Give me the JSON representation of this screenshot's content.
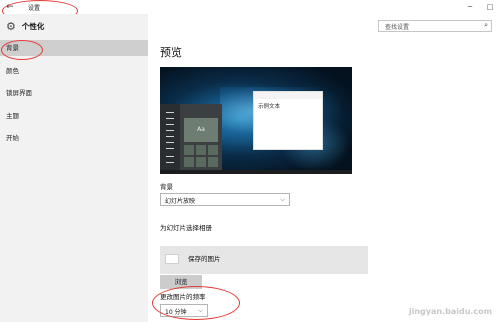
{
  "window": {
    "back_glyph": "←",
    "title": "设置",
    "minimize_glyph": "─",
    "maximize_glyph": "□"
  },
  "search": {
    "placeholder": "查找设置",
    "icon": "search-icon"
  },
  "sidebar": {
    "title": "个性化",
    "items": [
      {
        "label": "背景",
        "active": true
      },
      {
        "label": "颜色",
        "active": false
      },
      {
        "label": "锁屏界面",
        "active": false
      },
      {
        "label": "主题",
        "active": false
      },
      {
        "label": "开始",
        "active": false
      }
    ]
  },
  "main": {
    "title": "预览",
    "preview": {
      "tile_label": "Aa",
      "sample_text": "示例文本"
    },
    "background": {
      "label": "背景",
      "value": "幻灯片放映",
      "chevron": "⌵"
    },
    "album": {
      "label": "为幻灯片选择相册",
      "item": "保存的图片",
      "browse": "浏览"
    },
    "frequency": {
      "label": "更改图片的频率",
      "value": "10 分钟",
      "chevron": "⌵"
    }
  },
  "watermark": "jingyan.baidu.com",
  "colors": {
    "annotation": "#e53935",
    "active_nav": "#cfcfcf",
    "sidebar_bg": "#f2f2f2"
  }
}
